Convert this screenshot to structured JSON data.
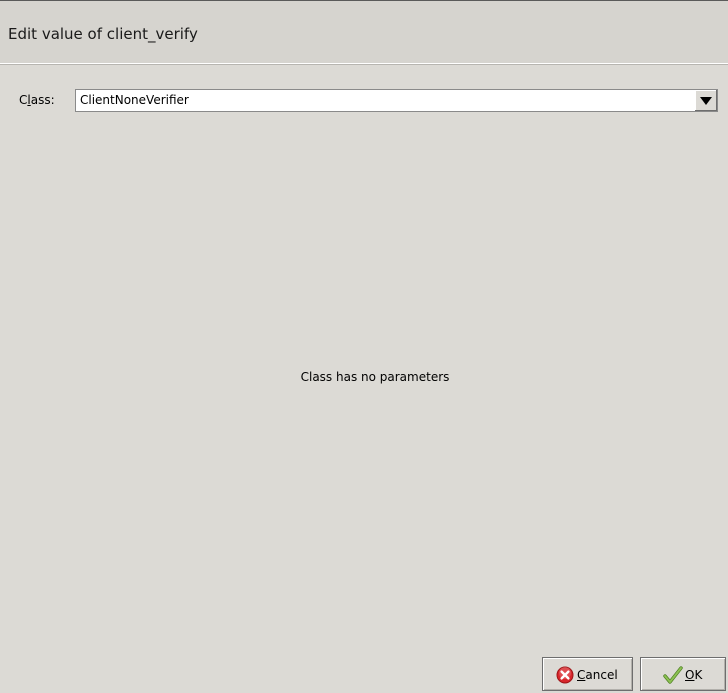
{
  "dialog": {
    "title": "Edit value of client_verify"
  },
  "class_field": {
    "label_prefix": "C",
    "label_mnemonic": "l",
    "label_suffix": "ass:",
    "value": "ClientNoneVerifier"
  },
  "message": "Class has no parameters",
  "buttons": {
    "cancel": {
      "mnemonic": "C",
      "rest": "ancel",
      "icon": "cancel-circle-icon",
      "icon_color": "#d8262b"
    },
    "ok": {
      "mnemonic": "O",
      "rest": "K",
      "icon": "checkmark-icon",
      "icon_color": "#6fa431"
    }
  }
}
